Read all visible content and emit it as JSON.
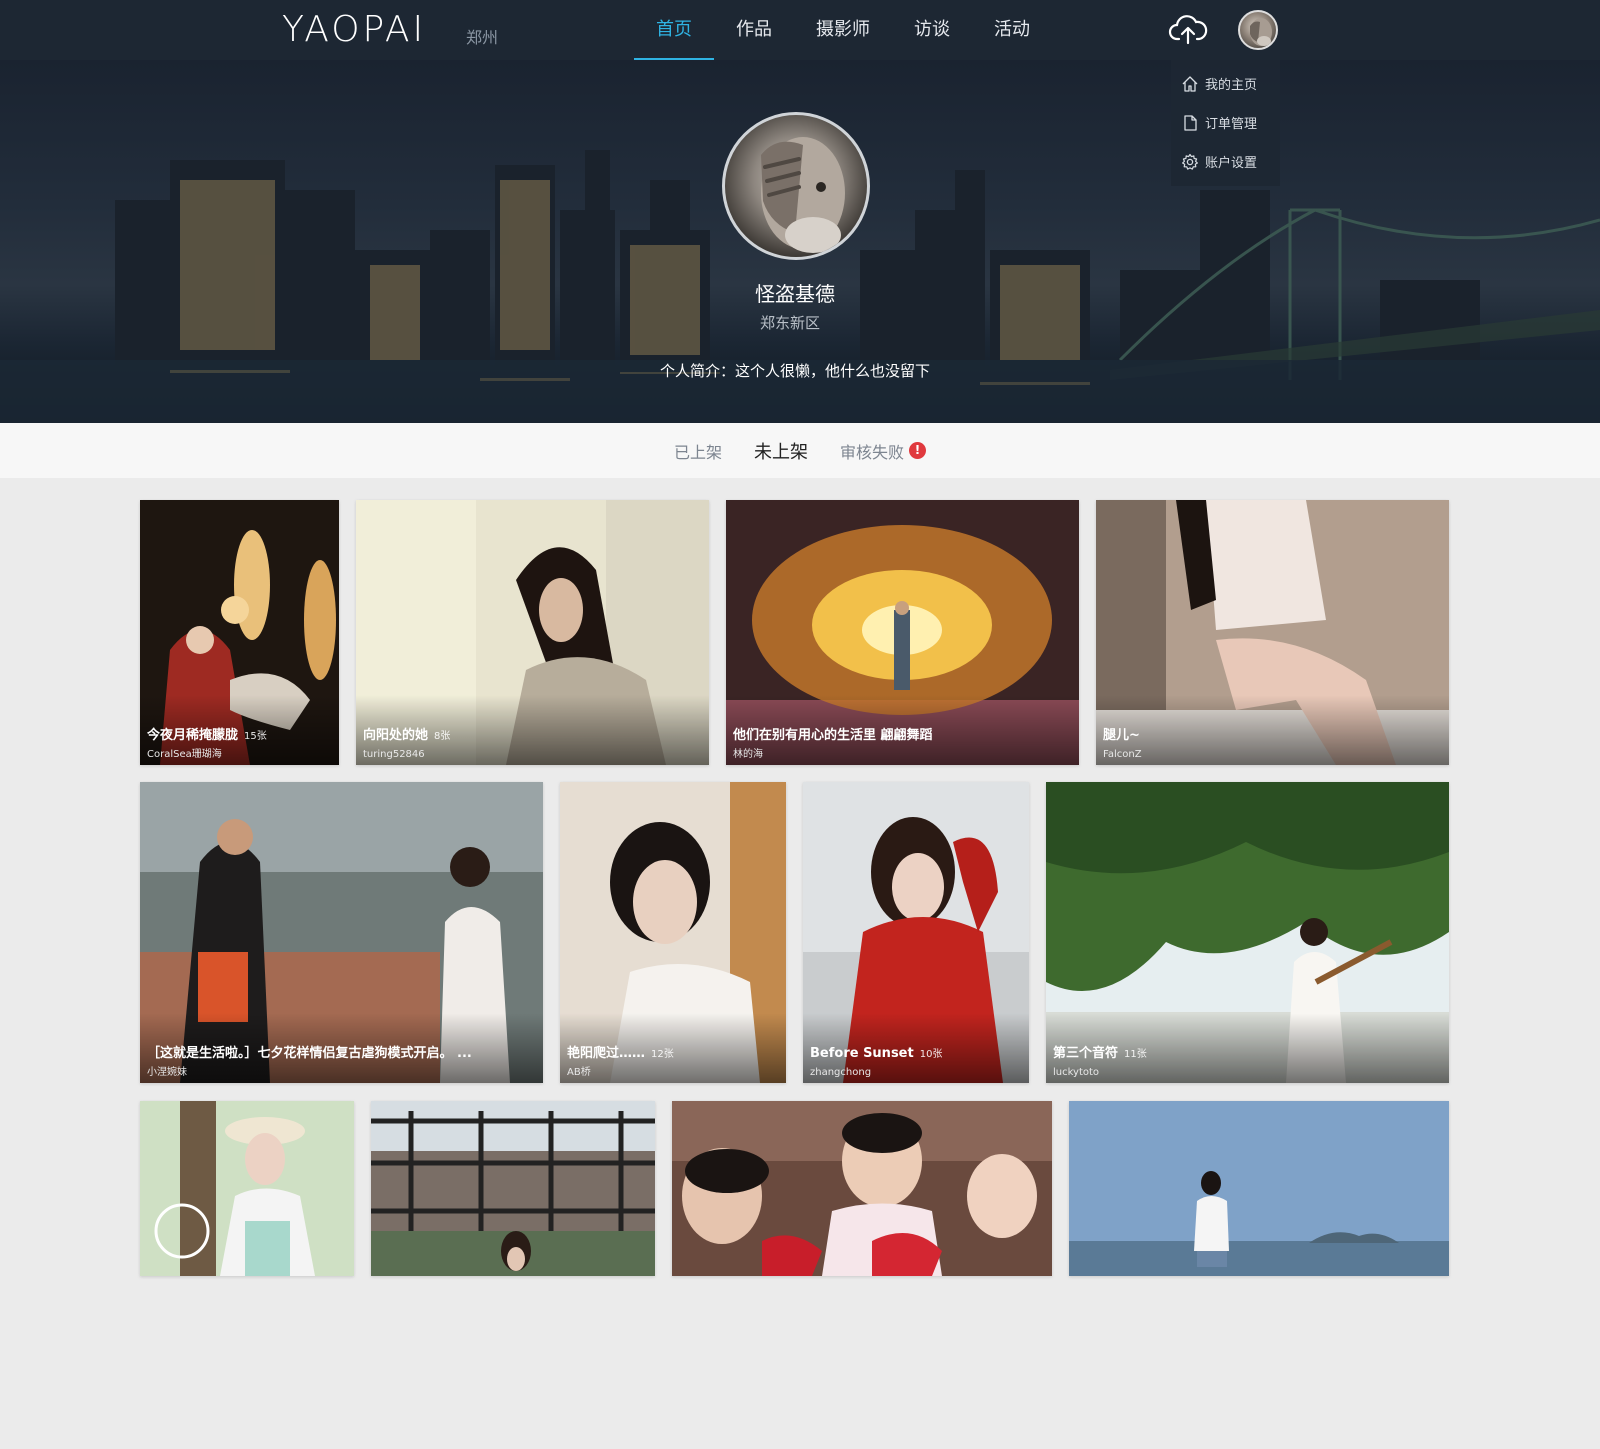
{
  "header": {
    "logo": "YAOPAI",
    "city": "郑州",
    "nav": [
      "首页",
      "作品",
      "摄影师",
      "访谈",
      "活动"
    ],
    "upload_icon": "cloud-upload-icon"
  },
  "user_menu": {
    "items": [
      {
        "label": "我的主页",
        "icon": "home-icon"
      },
      {
        "label": "订单管理",
        "icon": "document-icon"
      },
      {
        "label": "账户设置",
        "icon": "gear-icon"
      }
    ]
  },
  "profile": {
    "name": "怪盗基德",
    "area": "郑东新区",
    "bio": "个人简介：这个人很懒，他什么也没留下"
  },
  "tabs": {
    "items": [
      "已上架",
      "未上架",
      "审核失败"
    ],
    "active": "未上架",
    "alert": "!"
  },
  "albums": [
    {
      "title": "今夜月稀掩朦胧",
      "count": "15张",
      "author": "CoralSea珊瑚海"
    },
    {
      "title": "向阳处的她",
      "count": "8张",
      "author": "turing52846"
    },
    {
      "title": "他们在别有用心的生活里 翩翩舞蹈",
      "count": "",
      "author": "林的海"
    },
    {
      "title": "腿儿~",
      "count": "",
      "author": "FalconZ"
    },
    {
      "title": "［这就是生活啦。］七夕花样情侣复古虐狗模式开启。 ...",
      "count": "",
      "author": "小涅婉妹"
    },
    {
      "title": "艳阳爬过……",
      "count": "12张",
      "author": "AB桥"
    },
    {
      "title": "Before Sunset",
      "count": "10张",
      "author": "zhangchong"
    },
    {
      "title": "第三个音符",
      "count": "11张",
      "author": "luckytoto"
    },
    {
      "title": "",
      "count": "",
      "author": ""
    },
    {
      "title": "",
      "count": "",
      "author": ""
    },
    {
      "title": "",
      "count": "",
      "author": ""
    },
    {
      "title": "",
      "count": "",
      "author": ""
    }
  ],
  "colors": {
    "nav_bg": "#1d2733",
    "accent": "#2fb3e3",
    "alert": "#e0393e",
    "page_bg": "#ebebeb"
  }
}
